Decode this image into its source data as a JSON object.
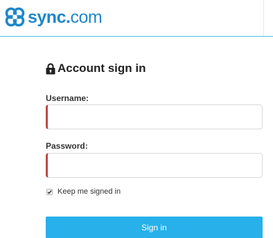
{
  "brand": {
    "logo_icon": "sync-logo-icon",
    "name_bold": "sync",
    "name_dot": ".",
    "name_rest": "com",
    "color": "#1e87c9"
  },
  "form": {
    "title": "Account sign in",
    "title_icon": "lock-icon",
    "username_label": "Username:",
    "username_value": "",
    "password_label": "Password:",
    "password_value": "",
    "remember_label": "Keep me signed in",
    "remember_checked": true,
    "submit_label": "Sign in"
  },
  "colors": {
    "accent": "#27b0ea",
    "error_border": "#b94a48",
    "header_line": "#4bc0e4"
  }
}
